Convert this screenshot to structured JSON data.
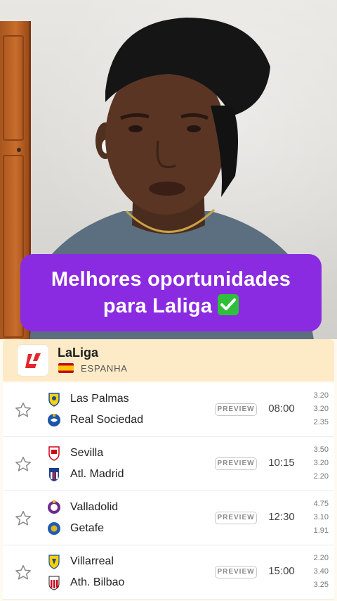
{
  "caption": {
    "line1": "Melhores oportunidades",
    "line2": "para Laliga"
  },
  "league": {
    "name": "LaLiga",
    "country": "ESPANHA"
  },
  "matches": [
    {
      "home": "Las Palmas",
      "away": "Real Sociedad",
      "status": "PREVIEW",
      "time": "08:00",
      "odds": [
        "3.20",
        "3.20",
        "2.35"
      ]
    },
    {
      "home": "Sevilla",
      "away": "Atl. Madrid",
      "status": "PREVIEW",
      "time": "10:15",
      "odds": [
        "3.50",
        "3.20",
        "2.20"
      ]
    },
    {
      "home": "Valladolid",
      "away": "Getafe",
      "status": "PREVIEW",
      "time": "12:30",
      "odds": [
        "4.75",
        "3.10",
        "1.91"
      ]
    },
    {
      "home": "Villarreal",
      "away": "Ath. Bilbao",
      "status": "PREVIEW",
      "time": "15:00",
      "odds": [
        "2.20",
        "3.40",
        "3.25"
      ]
    }
  ],
  "colors": {
    "caption_bg": "#8a2be2",
    "header_bg": "#fdebc8",
    "laliga_red": "#e3272b"
  }
}
